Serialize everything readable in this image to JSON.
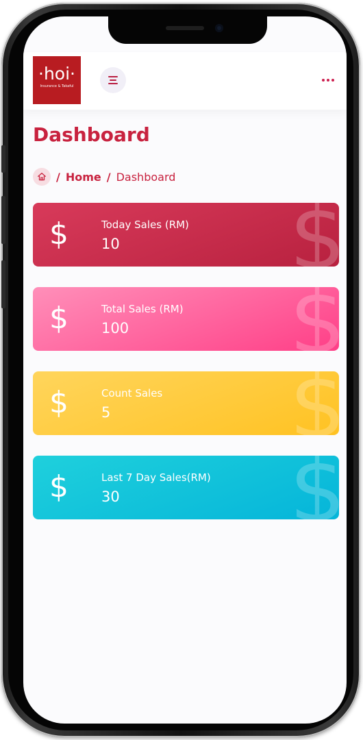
{
  "header": {
    "logo_text": "·hoi·",
    "logo_tagline": "Insurance & Takaful"
  },
  "page": {
    "title": "Dashboard"
  },
  "breadcrumb": {
    "home": "Home",
    "separator": "/",
    "current": "Dashboard"
  },
  "cards": [
    {
      "label": "Today Sales (RM)",
      "value": "10",
      "icon": "dollar-icon",
      "color": "#c8223f"
    },
    {
      "label": "Total Sales (RM)",
      "value": "100",
      "icon": "dollar-icon",
      "color": "#ff4f8f"
    },
    {
      "label": "Count Sales",
      "value": "5",
      "icon": "dollar-icon",
      "color": "#ffc62b"
    },
    {
      "label": "Last 7 Day Sales(RM)",
      "value": "30",
      "icon": "dollar-icon",
      "color": "#0fbcd8"
    }
  ],
  "colors": {
    "accent": "#c8223f",
    "logo_bg": "#b81c21"
  }
}
